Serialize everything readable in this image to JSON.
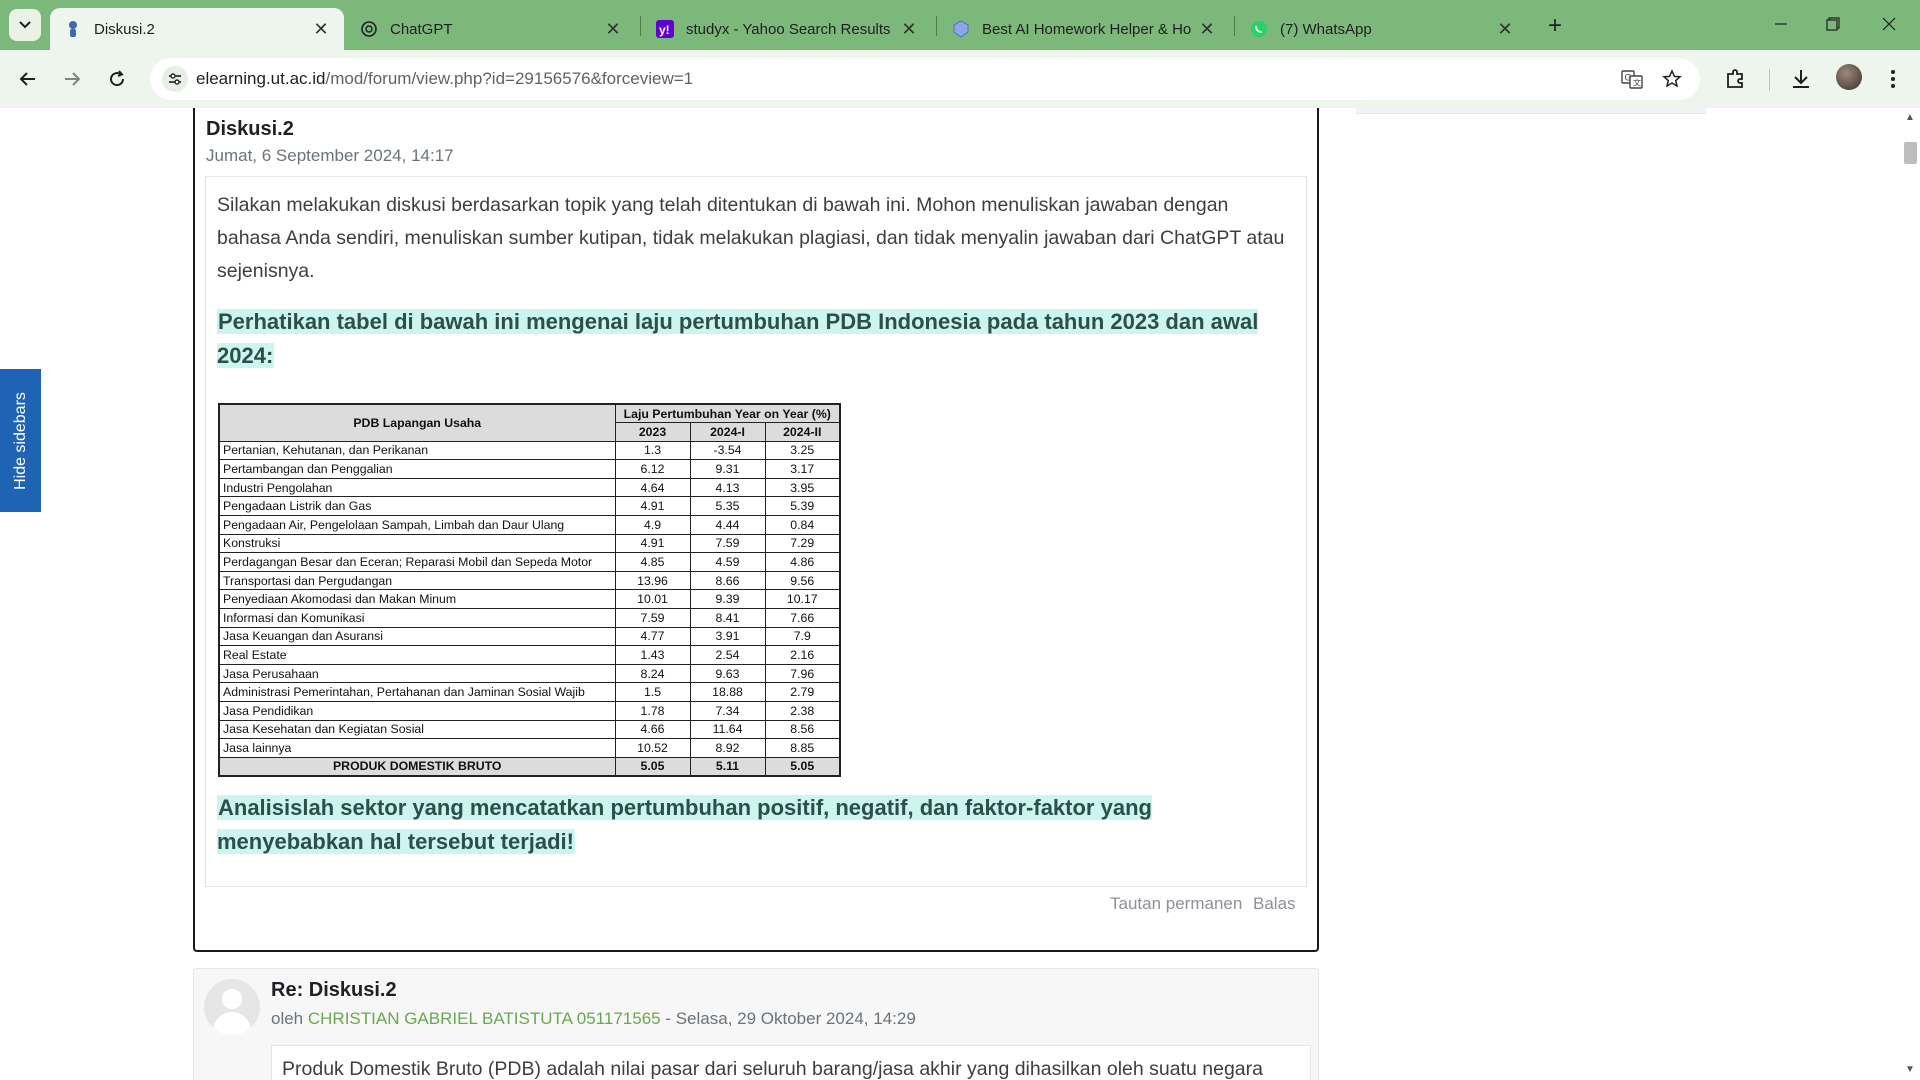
{
  "browser": {
    "tabs": [
      {
        "title": "Diskusi.2",
        "active": true,
        "icon": "elearning-favicon"
      },
      {
        "title": "ChatGPT",
        "active": false,
        "icon": "chatgpt-icon"
      },
      {
        "title": "studyx - Yahoo Search Results",
        "active": false,
        "icon": "yahoo-icon"
      },
      {
        "title": "Best AI Homework Helper & Ho",
        "active": false,
        "icon": "shield-icon"
      },
      {
        "title": "(7) WhatsApp",
        "active": false,
        "icon": "whatsapp-icon"
      }
    ],
    "url_domain": "elearning.ut.ac.id",
    "url_path": "/mod/forum/view.php?id=29156576&forceview=1",
    "accent_color": "#7cb87a"
  },
  "sidebar_toggle": {
    "label": "Hide sidebars"
  },
  "post": {
    "title": "Diskusi.2",
    "date": "Jumat, 6 September 2024, 14:17",
    "intro": "Silakan melakukan diskusi berdasarkan topik yang telah ditentukan di bawah ini. Mohon menuliskan jawaban dengan bahasa Anda sendiri, menuliskan sumber kutipan, tidak melakukan plagiasi, dan tidak menyalin jawaban dari ChatGPT atau sejenisnya.",
    "question1": "Perhatikan tabel di bawah ini mengenai laju pertumbuhan PDB Indonesia pada tahun 2023 dan awal 2024:",
    "question2": "Analisislah sektor yang mencatatkan pertumbuhan positif, negatif, dan faktor-faktor yang menyebabkan hal tersebut terjadi!",
    "permalink_label": "Tautan permanen",
    "reply_label": "Balas"
  },
  "table": {
    "col_sector": "PDB Lapangan Usaha",
    "col_group": "Laju Pertumbuhan Year on Year (%)",
    "col_years": [
      "2023",
      "2024-I",
      "2024-II"
    ],
    "rows": [
      {
        "name": "Pertanian, Kehutanan, dan Perikanan",
        "v1": "1.3",
        "v2": "-3.54",
        "v3": "3.25"
      },
      {
        "name": "Pertambangan dan Penggalian",
        "v1": "6.12",
        "v2": "9.31",
        "v3": "3.17"
      },
      {
        "name": "Industri Pengolahan",
        "v1": "4.64",
        "v2": "4.13",
        "v3": "3.95"
      },
      {
        "name": "Pengadaan Listrik dan Gas",
        "v1": "4.91",
        "v2": "5.35",
        "v3": "5.39"
      },
      {
        "name": "Pengadaan Air, Pengelolaan Sampah, Limbah dan Daur Ulang",
        "v1": "4.9",
        "v2": "4.44",
        "v3": "0.84"
      },
      {
        "name": "Konstruksi",
        "v1": "4.91",
        "v2": "7.59",
        "v3": "7.29"
      },
      {
        "name": "Perdagangan Besar dan Eceran; Reparasi Mobil dan Sepeda Motor",
        "v1": "4.85",
        "v2": "4.59",
        "v3": "4.86"
      },
      {
        "name": "Transportasi dan Pergudangan",
        "v1": "13.96",
        "v2": "8.66",
        "v3": "9.56"
      },
      {
        "name": "Penyediaan Akomodasi dan Makan Minum",
        "v1": "10.01",
        "v2": "9.39",
        "v3": "10.17"
      },
      {
        "name": "Informasi dan Komunikasi",
        "v1": "7.59",
        "v2": "8.41",
        "v3": "7.66"
      },
      {
        "name": "Jasa Keuangan dan Asuransi",
        "v1": "4.77",
        "v2": "3.91",
        "v3": "7.9"
      },
      {
        "name": "Real Estate",
        "v1": "1.43",
        "v2": "2.54",
        "v3": "2.16"
      },
      {
        "name": "Jasa Perusahaan",
        "v1": "8.24",
        "v2": "9.63",
        "v3": "7.96"
      },
      {
        "name": "Administrasi Pemerintahan, Pertahanan dan Jaminan Sosial Wajib",
        "v1": "1.5",
        "v2": "18.88",
        "v3": "2.79"
      },
      {
        "name": "Jasa Pendidikan",
        "v1": "1.78",
        "v2": "7.34",
        "v3": "2.38"
      },
      {
        "name": "Jasa Kesehatan dan Kegiatan Sosial",
        "v1": "4.66",
        "v2": "11.64",
        "v3": "8.56"
      },
      {
        "name": "Jasa lainnya",
        "v1": "10.52",
        "v2": "8.92",
        "v3": "8.85"
      }
    ],
    "total": {
      "name": "PRODUK DOMESTIK BRUTO",
      "v1": "5.05",
      "v2": "5.11",
      "v3": "5.05"
    }
  },
  "reply": {
    "title": "Re: Diskusi.2",
    "by": "oleh",
    "author": "CHRISTIAN GABRIEL BATISTUTA 051171565",
    "date": " - Selasa, 29 Oktober 2024, 14:29",
    "excerpt": "Produk Domestik Bruto (PDB) adalah nilai pasar dari seluruh barang/jasa akhir yang dihasilkan oleh suatu negara"
  }
}
